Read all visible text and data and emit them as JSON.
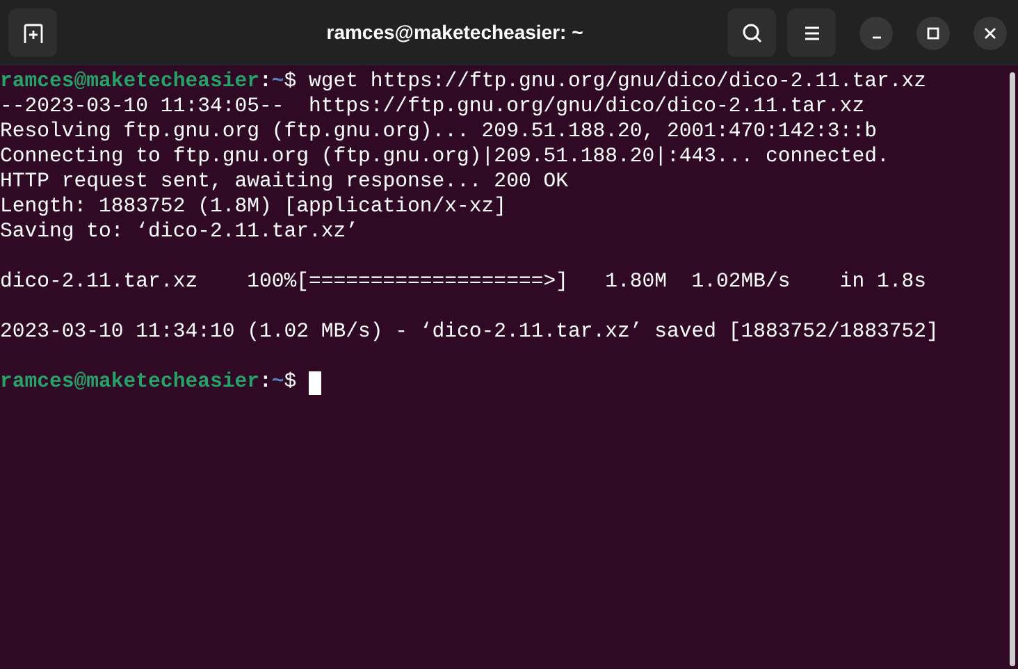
{
  "window": {
    "title": "ramces@maketecheasier: ~"
  },
  "terminal": {
    "lines": [
      {
        "kind": "prompt",
        "user_host": "ramces@maketecheasier",
        "colon": ":",
        "path": "~",
        "symbol": "$",
        "command": " wget https://ftp.gnu.org/gnu/dico/dico-2.11.tar.xz"
      },
      {
        "kind": "output",
        "text": "--2023-03-10 11:34:05--  https://ftp.gnu.org/gnu/dico/dico-2.11.tar.xz"
      },
      {
        "kind": "output",
        "text": "Resolving ftp.gnu.org (ftp.gnu.org)... 209.51.188.20, 2001:470:142:3::b"
      },
      {
        "kind": "output",
        "text": "Connecting to ftp.gnu.org (ftp.gnu.org)|209.51.188.20|:443... connected."
      },
      {
        "kind": "output",
        "text": "HTTP request sent, awaiting response... 200 OK"
      },
      {
        "kind": "output",
        "text": "Length: 1883752 (1.8M) [application/x-xz]"
      },
      {
        "kind": "output",
        "text": "Saving to: ‘dico-2.11.tar.xz’"
      },
      {
        "kind": "blank"
      },
      {
        "kind": "output",
        "text": "dico-2.11.tar.xz    100%[===================>]   1.80M  1.02MB/s    in 1.8s"
      },
      {
        "kind": "blank"
      },
      {
        "kind": "output",
        "text": "2023-03-10 11:34:10 (1.02 MB/s) - ‘dico-2.11.tar.xz’ saved [1883752/1883752]"
      },
      {
        "kind": "blank"
      },
      {
        "kind": "prompt",
        "user_host": "ramces@maketecheasier",
        "colon": ":",
        "path": "~",
        "symbol": "$",
        "cursor": true
      }
    ]
  }
}
